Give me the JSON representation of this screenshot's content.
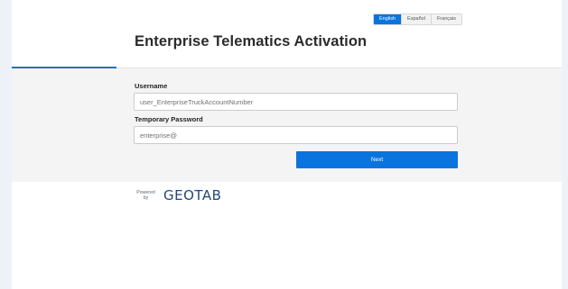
{
  "language_switch": {
    "options": [
      "English",
      "Español",
      "Français"
    ],
    "selected": "English"
  },
  "header": {
    "title": "Enterprise Telematics Activation"
  },
  "form": {
    "username_label": "Username",
    "username_value": "user_EnterpriseTruckAccountNumber",
    "password_label": "Temporary Password",
    "password_value": "enterprise@",
    "next_label": "Next"
  },
  "footer": {
    "powered_line1": "Powered",
    "powered_line2": "by",
    "brand": "GEOTAB"
  },
  "colors": {
    "accent": "#0a74de",
    "brand": "#25477b",
    "form_background": "#f4f4f4"
  }
}
